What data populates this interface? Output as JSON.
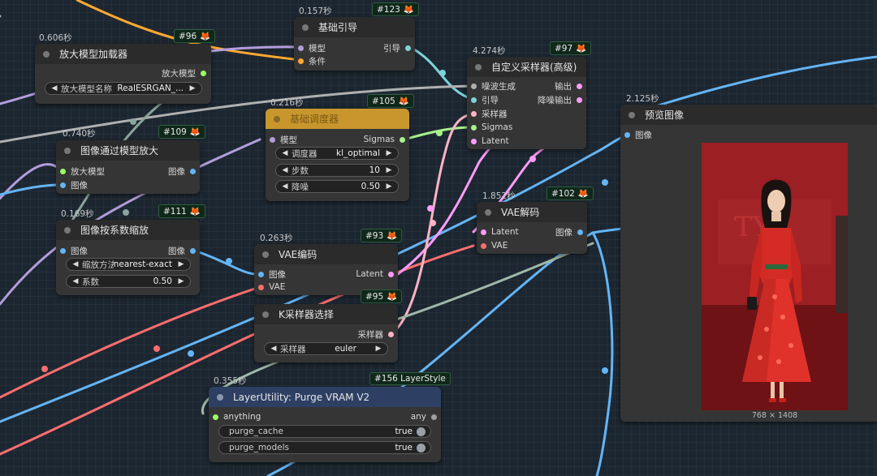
{
  "colors": {
    "model": "#b39ddb",
    "image": "#64b5f6",
    "latent": "#ff9cf9",
    "vae": "#ff6e6e",
    "sigmas": "#a5f28b",
    "sampler": "#ffb3c6",
    "noise": "#b0b0b0",
    "guide": "#7dd3d8",
    "cond": "#ffa931",
    "upscale_model": "#98ff66",
    "any": "#a0a0a0"
  },
  "nodes": {
    "n96": {
      "time": "0.606秒",
      "id": "#96",
      "title": "放大模型加载器",
      "out1": "放大模型",
      "w1_label": "放大模型名称",
      "w1_value": "RealESRGAN_..."
    },
    "n123": {
      "time": "0.157秒",
      "id": "#123",
      "title": "基础引导",
      "in1": "模型",
      "in2": "条件",
      "out1": "引导"
    },
    "n97": {
      "time": "4.274秒",
      "id": "#97",
      "title": "自定义采样器(高级)",
      "in1": "噪波生成",
      "in2": "引导",
      "in3": "采样器",
      "in4": "Sigmas",
      "in5": "Latent",
      "out1": "输出",
      "out2": "降噪输出"
    },
    "n105": {
      "time": "0.216秒",
      "id": "#105",
      "title": "基础调度器",
      "in1": "模型",
      "out1": "Sigmas",
      "w1_label": "调度器",
      "w1_value": "kl_optimal",
      "w2_label": "步数",
      "w2_value": "10",
      "w3_label": "降噪",
      "w3_value": "0.50"
    },
    "n109": {
      "time": "0.740秒",
      "id": "#109",
      "title": "图像通过模型放大",
      "in1": "放大模型",
      "in2": "图像",
      "out1": "图像"
    },
    "n111": {
      "time": "0.169秒",
      "id": "#111",
      "title": "图像按系数缩放",
      "in1": "图像",
      "out1": "图像",
      "w1_label": "缩放方法",
      "w1_value": "nearest-exact",
      "w2_label": "系数",
      "w2_value": "0.50"
    },
    "n93": {
      "time": "0.263秒",
      "id": "#93",
      "title": "VAE编码",
      "in1": "图像",
      "in2": "VAE",
      "out1": "Latent"
    },
    "n95": {
      "id": "#95",
      "title": "K采样器选择",
      "out1": "采样器",
      "w1_label": "采样器",
      "w1_value": "euler"
    },
    "n102": {
      "time": "1.852秒",
      "id": "#102",
      "title": "VAE解码",
      "in1": "Latent",
      "in2": "VAE",
      "out1": "图像"
    },
    "n156": {
      "time": "0.355秒",
      "id": "#156 LayerStyle",
      "title": "LayerUtility: Purge VRAM V2",
      "in1": "anything",
      "out1": "any",
      "w1_label": "purge_cache",
      "w1_value": "true",
      "w2_label": "purge_models",
      "w2_value": "true"
    },
    "preview": {
      "time": "2.125秒",
      "title": "预览图像",
      "in1": "图像",
      "size": "768 × 1408"
    }
  }
}
